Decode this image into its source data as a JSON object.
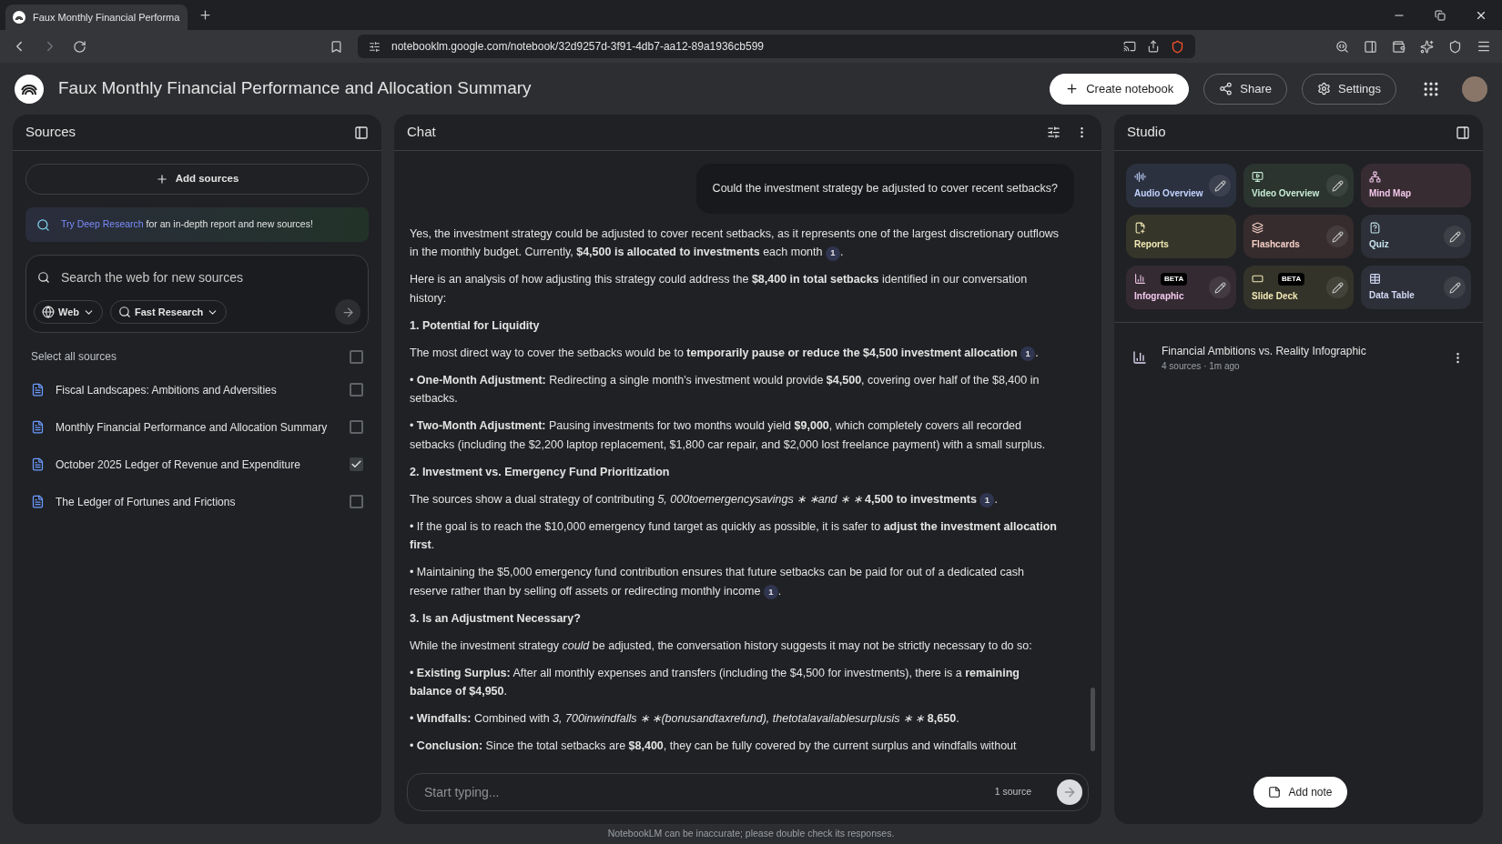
{
  "browser": {
    "tab_title": "Faux Monthly Financial Performa",
    "url": "notebooklm.google.com/notebook/32d9257d-3f91-4db7-aa12-89a1936cb599"
  },
  "header": {
    "title": "Faux Monthly Financial Performance and Allocation Summary",
    "buttons": [
      {
        "kind": "create",
        "label": "Create notebook"
      },
      {
        "kind": "share",
        "label": "Share"
      },
      {
        "kind": "settings",
        "label": "Settings"
      }
    ]
  },
  "sources": {
    "title": "Sources",
    "add_button": "Add sources",
    "promo": {
      "link": "Try Deep Research",
      "text": "for an in-depth report and new sources!"
    },
    "search": {
      "placeholder": "Search the web for new sources",
      "filters": [
        {
          "kind": "web",
          "label": "Web"
        },
        {
          "kind": "research",
          "label": "Fast Research"
        }
      ]
    },
    "select_all": {
      "label": "Select all sources",
      "checked": false
    },
    "items": [
      {
        "title": "Fiscal Landscapes: Ambitions and Adversities",
        "checked": false
      },
      {
        "title": "Monthly Financial Performance and Allocation Summary",
        "checked": false
      },
      {
        "title": "October 2025 Ledger of Revenue and Expenditure",
        "checked": true
      },
      {
        "title": "The Ledger of Fortunes and Frictions",
        "checked": false
      }
    ]
  },
  "chat": {
    "title": "Chat",
    "user_message": "Could the investment strategy be adjusted to cover recent setbacks?",
    "response": [
      {
        "kind": "p",
        "text": "Yes, the investment strategy could be adjusted to cover recent setbacks, as it represents one of the largest discretionary outflows in the monthly budget. Currently, **$4,500 is allocated to investments** each month",
        "citation": "1",
        "after": "."
      },
      {
        "kind": "p",
        "text": "Here is an analysis of how adjusting this strategy could address the **$8,400 in total setbacks** identified in our conversation history:"
      },
      {
        "kind": "heading",
        "text": "1. Potential for Liquidity"
      },
      {
        "kind": "p",
        "text": "The most direct way to cover the setbacks would be to **temporarily pause or reduce the $4,500 investment allocation**",
        "citation": "1",
        "after": "."
      },
      {
        "kind": "p",
        "text": "• **One-Month Adjustment:** Redirecting a single month's investment would provide **$4,500**, covering over half of the $8,400 in setbacks."
      },
      {
        "kind": "p",
        "text": "• **Two-Month Adjustment:** Pausing investments for two months would yield **$9,000**, which completely covers all recorded setbacks (including the $2,200 laptop replacement, $1,800 car repair, and $2,000 lost freelance payment) with a small surplus."
      },
      {
        "kind": "heading",
        "text": "2. Investment vs. Emergency Fund Prioritization"
      },
      {
        "kind": "p",
        "text": "The sources show a dual strategy of contributing *5, 000toemergencysavings ∗ ∗and ∗ ∗* **4,500 to investments**",
        "citation": "1",
        "after": "."
      },
      {
        "kind": "p",
        "text": "• If the goal is to reach the $10,000 emergency fund target as quickly as possible, it is safer to **adjust the investment allocation first**."
      },
      {
        "kind": "p",
        "text": "• Maintaining the $5,000 emergency fund contribution ensures that future setbacks can be paid for out of a dedicated cash reserve rather than by selling off assets or redirecting monthly income",
        "citation": "1",
        "after": "."
      },
      {
        "kind": "heading",
        "text": "3. Is an Adjustment Necessary?"
      },
      {
        "kind": "p",
        "text": "While the investment strategy *could* be adjusted, the conversation history suggests it may not be strictly necessary to do so:"
      },
      {
        "kind": "p",
        "text": "• **Existing Surplus:** After all monthly expenses and transfers (including the $4,500 for investments), there is a **remaining balance of $4,950**."
      },
      {
        "kind": "p",
        "text": "• **Windfalls:** Combined with *3, 700inwindfalls ∗ ∗(bonusandtaxrefund), thetotalavailablesurplusis ∗ ∗* **8,650**."
      },
      {
        "kind": "p",
        "text": "• **Conclusion:** Since the total setbacks are **$8,400**, they can be fully covered by the current surplus and windfalls without"
      }
    ],
    "input": {
      "placeholder": "Start typing...",
      "source_count": "1 source"
    }
  },
  "studio": {
    "title": "Studio",
    "tiles": [
      {
        "kind": "audio",
        "label": "Audio Overview",
        "editable": true,
        "color": "#2c3140"
      },
      {
        "kind": "video",
        "label": "Video Overview",
        "editable": true,
        "color": "#2b342f"
      },
      {
        "kind": "mindmap",
        "label": "Mind Map",
        "editable": false,
        "color": "#382c33"
      },
      {
        "kind": "reports",
        "label": "Reports",
        "editable": false,
        "color": "#36352a"
      },
      {
        "kind": "flashcards",
        "label": "Flashcards",
        "editable": true,
        "color": "#362c2d"
      },
      {
        "kind": "quiz",
        "label": "Quiz",
        "editable": true,
        "color": "#2d3038"
      },
      {
        "kind": "infographic",
        "label": "Infographic",
        "badge": "BETA",
        "editable": true,
        "color": "#342b32"
      },
      {
        "kind": "slides",
        "label": "Slide Deck",
        "badge": "BETA",
        "editable": true,
        "color": "#34332a"
      },
      {
        "kind": "table",
        "label": "Data Table",
        "editable": true,
        "color": "#2d3038"
      }
    ],
    "notes": [
      {
        "title": "Financial Ambitions vs. Reality Infographic",
        "meta": "4 sources · 1m ago"
      }
    ],
    "add_note": "Add note"
  },
  "footer": "NotebookLM can be inaccurate; please double check its responses."
}
